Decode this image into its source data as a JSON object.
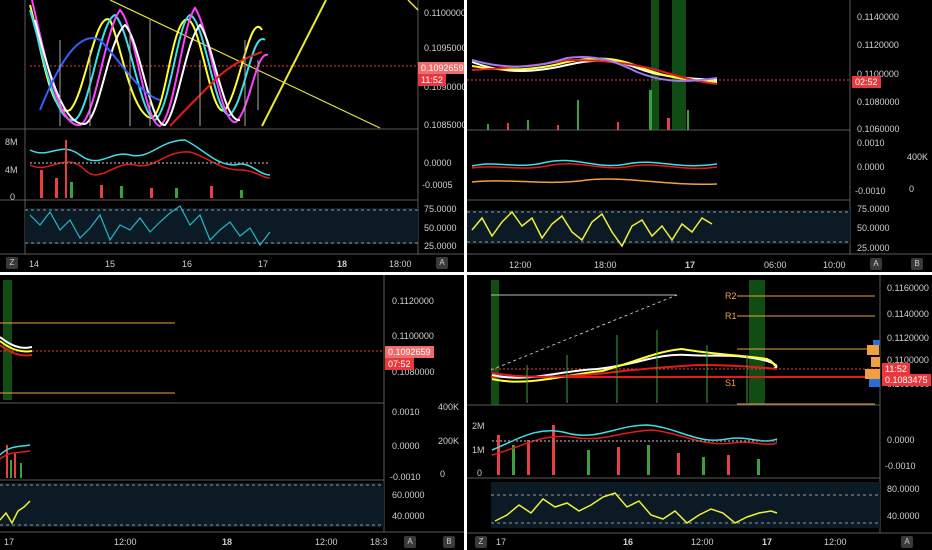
{
  "panes": {
    "top_left": {
      "price_ticks": [
        "0.1100000",
        "0.1095000",
        "0.1090000",
        "0.1085000"
      ],
      "last_price": "0.1092659",
      "countdown": "11:52",
      "volume_ticks": [
        "8M",
        "4M",
        "0"
      ],
      "macd_ticks": [
        "0.0000",
        "-0.0005"
      ],
      "macd_zero_tick": "0.0000",
      "rsi_ticks": [
        "75.0000",
        "50.0000",
        "25.0000"
      ],
      "time_ticks": [
        "14",
        "15",
        "16",
        "17",
        "18",
        "18:00"
      ],
      "scale_mode_button": "Z",
      "auto_button": "A"
    },
    "top_right": {
      "price_ticks": [
        "0.1140000",
        "0.1120000",
        "0.1100000",
        "0.1080000",
        "0.1060000"
      ],
      "countdown": "02:52",
      "macd_ticks": [
        "0.0010",
        "0.0000",
        "-0.0010"
      ],
      "volume_ticks": [
        "400K",
        "0"
      ],
      "rsi_ticks": [
        "75.0000",
        "50.0000",
        "25.0000"
      ],
      "time_ticks": [
        "12:00",
        "18:00",
        "17",
        "06:00",
        "10:00"
      ],
      "auto_button": "A",
      "b_button": "B"
    },
    "bottom_left": {
      "price_ticks": [
        "0.1120000",
        "0.1100000",
        "0.1080000"
      ],
      "last_price": "0.1092659",
      "countdown": "07:52",
      "macd_ticks": [
        "0.0010",
        "0.0000",
        "-0.0010"
      ],
      "volume_ticks": [
        "400K",
        "200K",
        "0"
      ],
      "rsi_ticks": [
        "60.0000",
        "40.0000"
      ],
      "time_ticks": [
        "17",
        "12:00",
        "18",
        "12:00",
        "18:3"
      ],
      "auto_button": "A",
      "b_button": "B"
    },
    "bottom_right": {
      "price_ticks": [
        "0.1160000",
        "0.1140000",
        "0.1120000",
        "0.1100000",
        "0.1080000"
      ],
      "countdown": "11:52",
      "last_price": "0.1083475",
      "levels": [
        "R2",
        "R1",
        "S1"
      ],
      "volume_ticks": [
        "2M",
        "1M",
        "0"
      ],
      "macd_ticks": [
        "0.0000",
        "-0.0010"
      ],
      "rsi_ticks": [
        "80.0000",
        "40.0000"
      ],
      "time_ticks": [
        "17",
        "16",
        "12:00",
        "17",
        "12:00"
      ],
      "scale_mode_button": "Z",
      "auto_button": "A"
    }
  },
  "colors": {
    "background": "#000000",
    "separator": "#ffffff",
    "price_tag": "#e8383d",
    "rsi_line_left": "#22b8c8",
    "rsi_line_right": "#f0f03a",
    "ma_red": "#e21b1b",
    "ma_yellow": "#ffff33",
    "ma_white": "#ffffff",
    "macd_cyan": "#3de0e8",
    "level_orange": "#f0a040",
    "session_green": "#0f4d14"
  }
}
